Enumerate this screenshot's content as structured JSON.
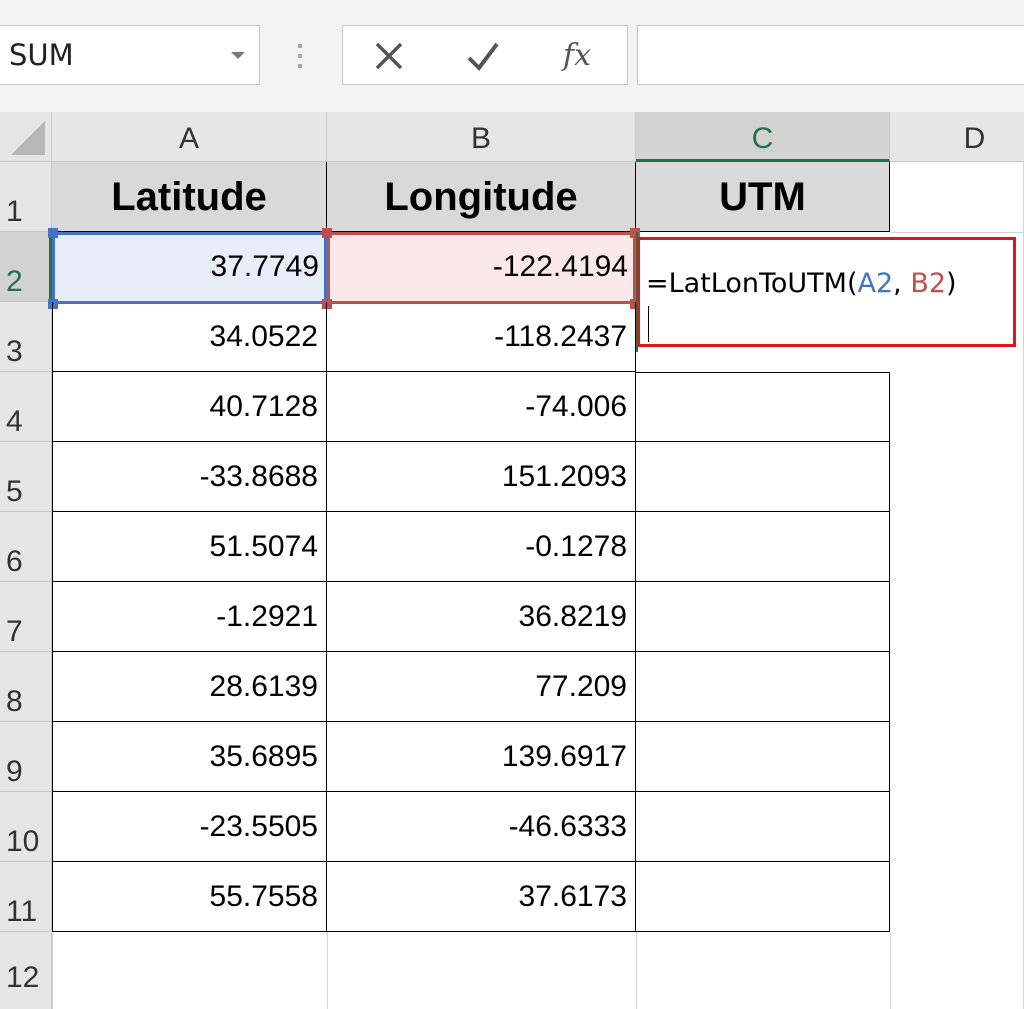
{
  "formula_bar": {
    "name_box": "SUM",
    "cancel_icon": "x-icon",
    "enter_icon": "check-icon",
    "function_label": "fx",
    "formula_input": ""
  },
  "columns": [
    "A",
    "B",
    "C",
    "D"
  ],
  "rows": [
    "1",
    "2",
    "3",
    "4",
    "5",
    "6",
    "7",
    "8",
    "9",
    "10",
    "11",
    "12"
  ],
  "headers": {
    "latitude": "Latitude",
    "longitude": "Longitude",
    "utm": "UTM"
  },
  "data": [
    {
      "lat": "37.7749",
      "lon": "-122.4194"
    },
    {
      "lat": "34.0522",
      "lon": "-118.2437"
    },
    {
      "lat": "40.7128",
      "lon": "-74.006"
    },
    {
      "lat": "-33.8688",
      "lon": "151.2093"
    },
    {
      "lat": "51.5074",
      "lon": "-0.1278"
    },
    {
      "lat": "-1.2921",
      "lon": "36.8219"
    },
    {
      "lat": "28.6139",
      "lon": "77.209"
    },
    {
      "lat": "35.6895",
      "lon": "139.6917"
    },
    {
      "lat": "-23.5505",
      "lon": "-46.6333"
    },
    {
      "lat": "55.7558",
      "lon": "37.6173"
    }
  ],
  "edit": {
    "prefix": "=LatLonToUTM(",
    "ref_a": "A2",
    "sep": ", ",
    "ref_b": "B2",
    "suffix": ")"
  },
  "colors": {
    "ref_a": "#4472c4",
    "ref_b": "#c0504d",
    "edit_border": "#e0161e",
    "selection": "#217346"
  }
}
